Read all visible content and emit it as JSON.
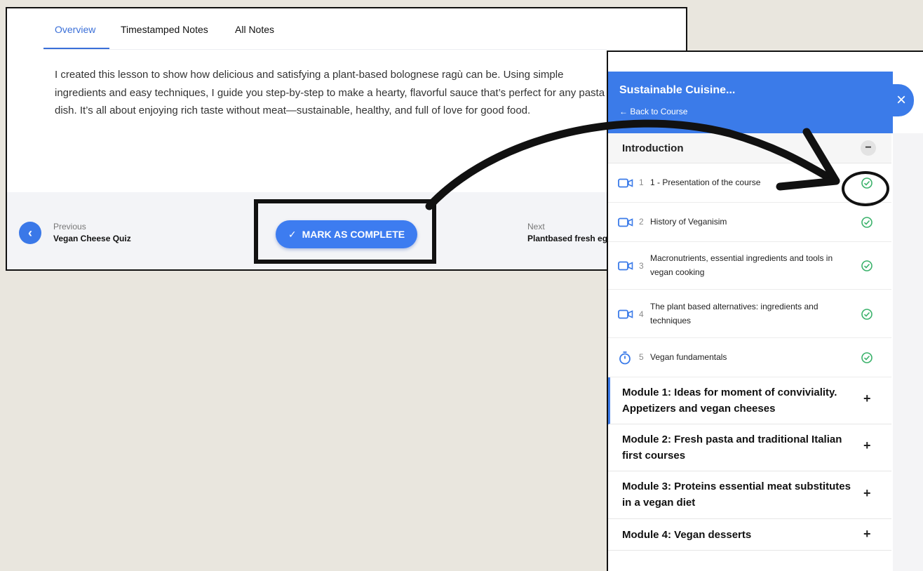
{
  "lesson": {
    "tabs": [
      {
        "label": "Overview"
      },
      {
        "label": "Timestamped Notes"
      },
      {
        "label": "All Notes"
      }
    ],
    "description": "I created this lesson to show how delicious and satisfying a plant-based bolognese ragù can be. Using simple ingredients and easy techniques, I guide you step-by-step to make a hearty, flavorful sauce that’s perfect for any pasta dish. It’s all about enjoying rich taste without meat—sustainable, healthy, and full of love for good food.",
    "previous_label": "Previous",
    "previous_title": "Vegan Cheese Quiz",
    "next_label": "Next",
    "next_title": "Plantbased fresh egg",
    "complete_button": "MARK AS COMPLETE"
  },
  "sidebar": {
    "course_title": "Sustainable Cuisine...",
    "back_link": "← Back to Course",
    "close_icon": "×",
    "section": {
      "title": "Introduction",
      "toggle": "−",
      "lessons": [
        {
          "num": "1",
          "title": "1 - Presentation of the course",
          "type": "video",
          "completed": true
        },
        {
          "num": "2",
          "title": "History of Veganisim",
          "type": "video",
          "completed": true
        },
        {
          "num": "3",
          "title": "Macronutrients, essential ingredients and tools in vegan cooking",
          "type": "video",
          "completed": true
        },
        {
          "num": "4",
          "title": "The plant based alternatives: ingredients and techniques",
          "type": "video",
          "completed": true
        },
        {
          "num": "5",
          "title": "Vegan fundamentals",
          "type": "quiz",
          "completed": true
        }
      ]
    },
    "modules": [
      {
        "title": "Module 1: Ideas for moment of conviviality. Appetizers and vegan cheeses",
        "toggle": "+"
      },
      {
        "title": "Module 2: Fresh pasta and traditional Italian first courses",
        "toggle": "+"
      },
      {
        "title": "Module 3: Proteins essential meat substitutes in a vegan diet",
        "toggle": "+"
      },
      {
        "title": "Module 4: Vegan desserts",
        "toggle": "+"
      }
    ]
  },
  "colors": {
    "accent": "#3b7be9",
    "complete_green": "#3bb26b",
    "annotation": "#111111"
  }
}
